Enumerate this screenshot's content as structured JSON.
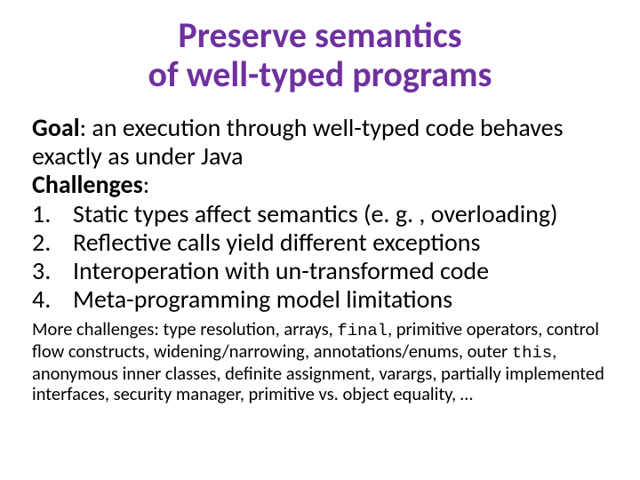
{
  "title_line1": "Preserve semantics",
  "title_line2": "of well-typed programs",
  "goal_label": "Goal",
  "goal_text": ":  an execution through well-typed code behaves exactly as under Java",
  "challenges_label": "Challenges",
  "challenges_colon": ":",
  "items": [
    {
      "num": "1.",
      "text": "Static types affect semantics (e. g. , overloading)"
    },
    {
      "num": "2.",
      "text": "Reflective calls yield different exceptions"
    },
    {
      "num": "3.",
      "text": "Interoperation with un-transformed code"
    },
    {
      "num": "4.",
      "text": "Meta-programming model limitations"
    }
  ],
  "more_a": "More challenges:  type resolution, arrays, ",
  "more_code1": "final",
  "more_b": ", primitive operators, control flow constructs, widening/narrowing, annotations/enums, outer ",
  "more_code2": "this",
  "more_c": ", anonymous inner classes, definite assignment, varargs, partially implemented interfaces, security manager, primitive vs. object equality, …"
}
